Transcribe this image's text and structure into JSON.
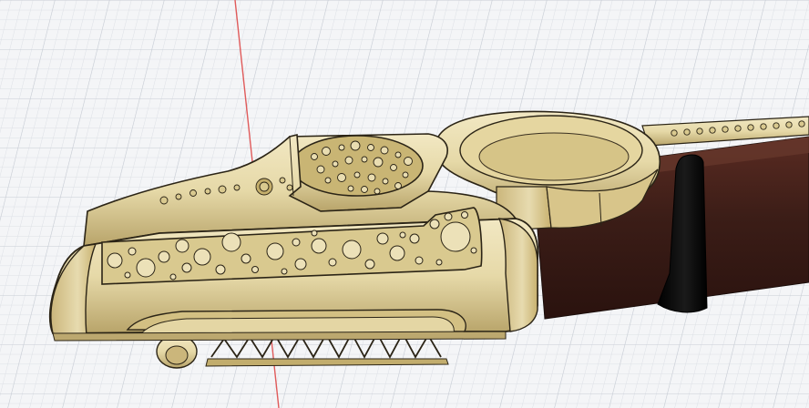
{
  "app": {
    "viewport_label": ""
  },
  "scene": {
    "grid": true,
    "background": "#f4f5f7",
    "grid_minor_color": "#d9dde3",
    "grid_major_color": "#c6cbd3",
    "origin_axis_color": "#e05a5a",
    "model": {
      "body_color": "#e6d9a8",
      "body_shadow_color": "#b8a46a",
      "edge_color": "#2b2416",
      "wood_color": "#3b1d17",
      "wood_highlight_color": "#6a3a2e",
      "band_color": "#0b0b0b"
    }
  }
}
